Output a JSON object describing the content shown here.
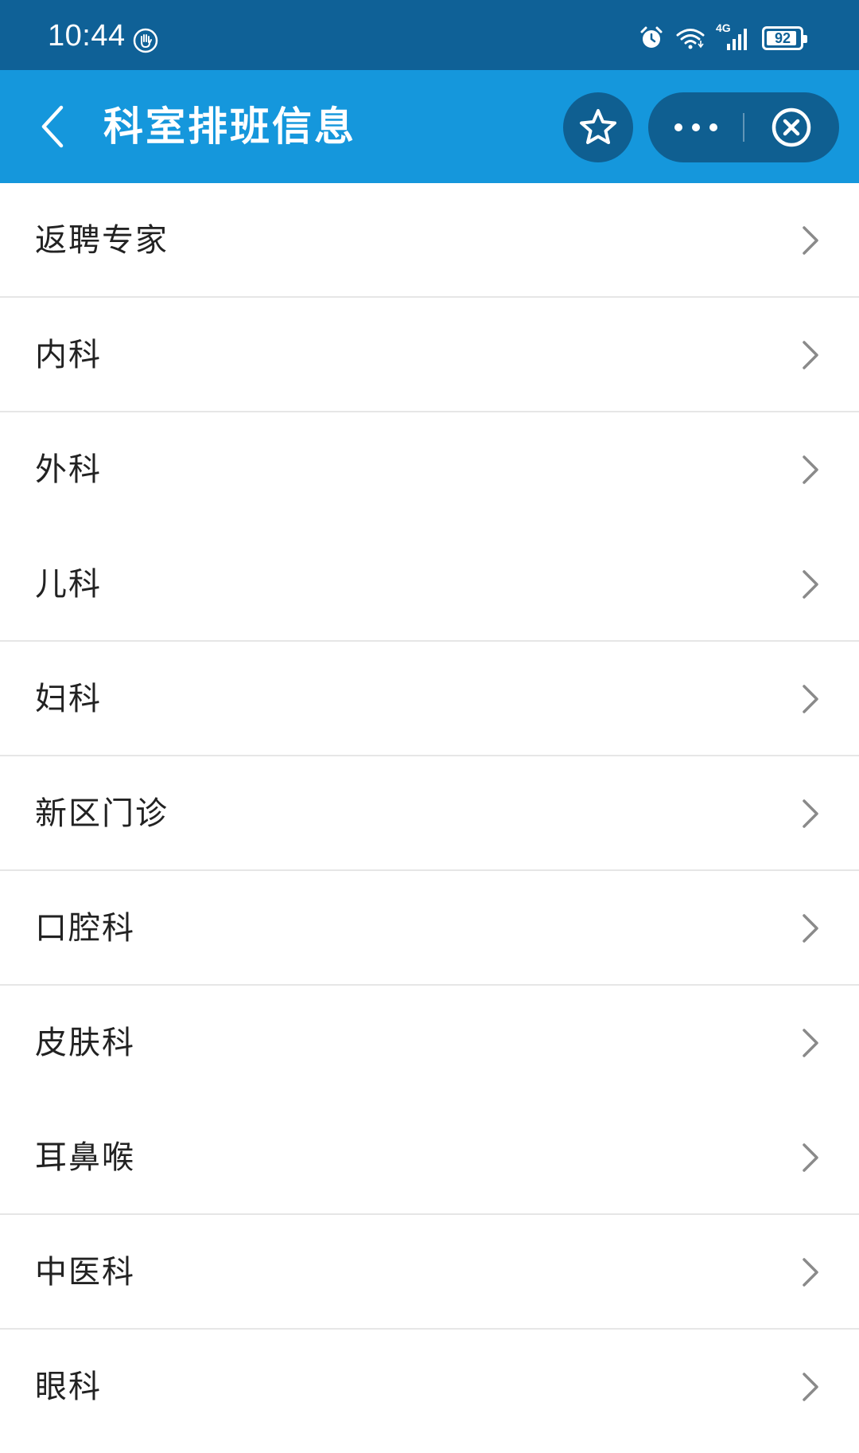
{
  "status_bar": {
    "time": "10:44",
    "network": "4G",
    "battery": "92",
    "battery_level": 0.92
  },
  "nav": {
    "title": "科室排班信息"
  },
  "departments": [
    {
      "label": "返聘专家",
      "divider": true
    },
    {
      "label": "内科",
      "divider": true
    },
    {
      "label": "外科",
      "divider": false
    },
    {
      "label": "儿科",
      "divider": true
    },
    {
      "label": "妇科",
      "divider": true
    },
    {
      "label": "新区门诊",
      "divider": true
    },
    {
      "label": "口腔科",
      "divider": true
    },
    {
      "label": "皮肤科",
      "divider": false
    },
    {
      "label": "耳鼻喉",
      "divider": true
    },
    {
      "label": "中医科",
      "divider": true
    },
    {
      "label": "眼科",
      "divider": false
    }
  ],
  "icons": {
    "back": "chevron-left-icon",
    "favorite": "star-icon",
    "more": "more-dots-icon",
    "close": "close-circle-icon",
    "row": "chevron-right-icon"
  },
  "colors": {
    "status_bar": "#0f6197",
    "nav_bar": "#1597dc",
    "capsule": "#0f5f91",
    "text": "#222222",
    "chevron": "#8a8a8a",
    "divider": "#e6e6e6"
  }
}
